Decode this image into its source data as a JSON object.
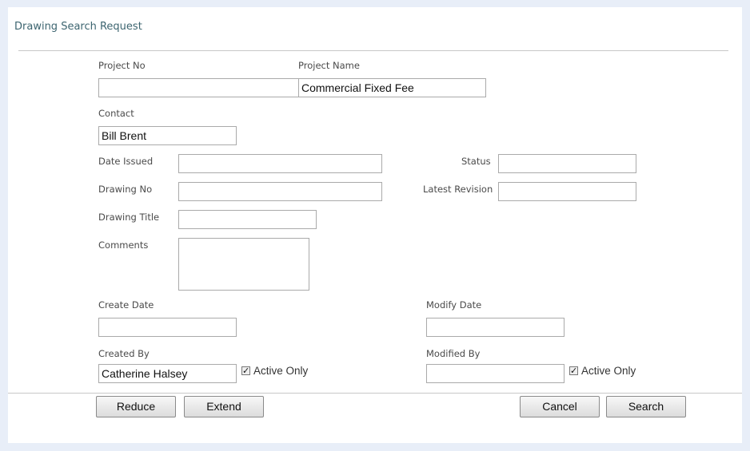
{
  "header": {
    "title": "Drawing Search Request"
  },
  "fields": {
    "project_no": {
      "label": "Project No",
      "value": ""
    },
    "project_name": {
      "label": "Project Name",
      "value": "Commercial Fixed Fee"
    },
    "contact": {
      "label": "Contact",
      "value": "Bill Brent"
    },
    "date_issued": {
      "label": "Date Issued",
      "value": ""
    },
    "status": {
      "label": "Status",
      "value": ""
    },
    "drawing_no": {
      "label": "Drawing No",
      "value": ""
    },
    "latest_revision": {
      "label": "Latest Revision",
      "value": ""
    },
    "drawing_title": {
      "label": "Drawing Title",
      "value": ""
    },
    "comments": {
      "label": "Comments",
      "value": ""
    },
    "create_date": {
      "label": "Create Date",
      "value": ""
    },
    "modify_date": {
      "label": "Modify Date",
      "value": ""
    },
    "created_by": {
      "label": "Created By",
      "value": "Catherine Halsey",
      "active_only_label": "Active Only",
      "active_only_checked": true
    },
    "modified_by": {
      "label": "Modified By",
      "value": "",
      "active_only_label": "Active Only",
      "active_only_checked": true
    }
  },
  "buttons": {
    "reduce": "Reduce",
    "extend": "Extend",
    "cancel": "Cancel",
    "search": "Search"
  }
}
